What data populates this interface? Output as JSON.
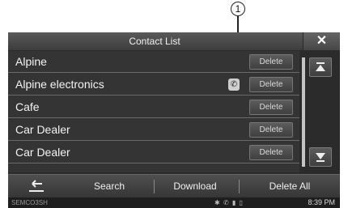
{
  "callout": {
    "number": "1"
  },
  "header": {
    "title": "Contact List",
    "close_icon": "close-icon"
  },
  "contacts": [
    {
      "name": "Alpine",
      "delete_label": "Delete"
    },
    {
      "name": "Alpine electronics",
      "delete_label": "Delete",
      "has_handset_icon": true
    },
    {
      "name": "Cafe",
      "delete_label": "Delete"
    },
    {
      "name": "Car Dealer",
      "delete_label": "Delete"
    },
    {
      "name": "Car Dealer",
      "delete_label": "Delete"
    }
  ],
  "scrollbar": {
    "top_icon": "scroll-to-top-icon",
    "bottom_icon": "scroll-to-bottom-icon"
  },
  "toolbar": {
    "back_icon": "back-arrow-icon",
    "search_label": "Search",
    "download_label": "Download",
    "delete_all_label": "Delete All"
  },
  "status": {
    "left_label": "SEMCO3SH",
    "time": "8:39 PM"
  },
  "colors": {
    "background": "#2b2b2b",
    "text": "#f4f4f4",
    "button": "#4a4a4a"
  }
}
